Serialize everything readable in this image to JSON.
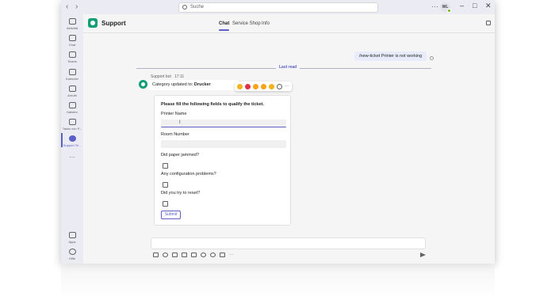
{
  "titlebar": {
    "search_placeholder": "Suche",
    "user_initials": "WL"
  },
  "rail": {
    "items": [
      {
        "label": "Aktivität"
      },
      {
        "label": "Chat"
      },
      {
        "label": "Teams"
      },
      {
        "label": "Kalender"
      },
      {
        "label": "Anrufe"
      },
      {
        "label": "Dateien"
      },
      {
        "label": "Tasks von P..."
      },
      {
        "label": "Support Te..."
      }
    ],
    "more_label": "···",
    "apps_label": "Apps",
    "help_label": "Hilfe"
  },
  "header": {
    "title": "Support",
    "tabs": [
      "Chat",
      "Service Shop",
      "Info"
    ]
  },
  "chat": {
    "sent_message": "/new-ticket Printer is not working",
    "last_read": "Last read",
    "bot_sender": "Support bot",
    "bot_time": "17:11",
    "bot_message_prefix": "Category updated to: ",
    "bot_message_value": "Drucker",
    "reactions_more": "···"
  },
  "card": {
    "title": "Please fill the following fields to qualify the ticket.",
    "printer_name_label": "Printer Name",
    "room_number_label": "Room Number",
    "paper_jammed_label": "Did paper jammed?",
    "config_problems_label": "Any configuration problems?",
    "reset_label": "Did you try to reset?",
    "submit_label": "Submit"
  },
  "composer": {
    "more_label": "···"
  },
  "colors": {
    "accent": "#5b5fc7",
    "bot_green": "#0f9e76"
  }
}
